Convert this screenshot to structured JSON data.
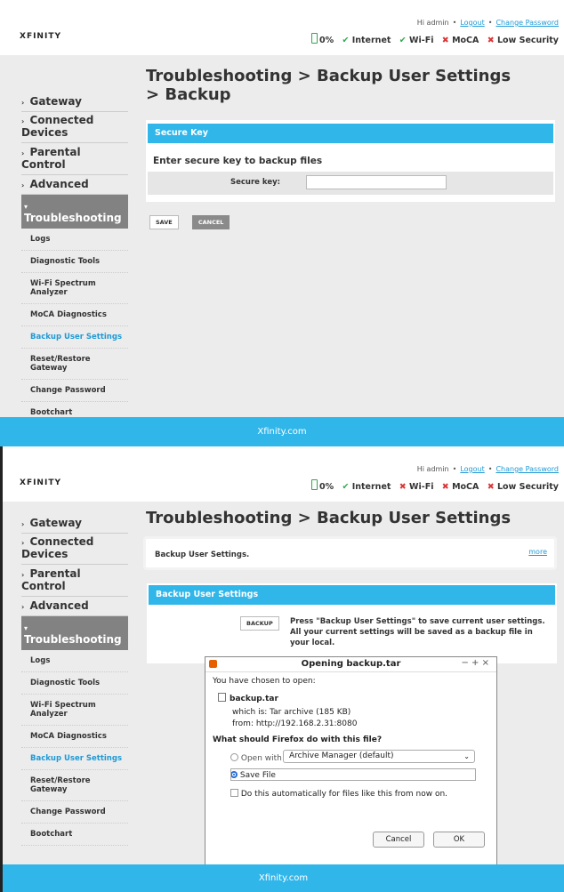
{
  "brand": "XFINITY",
  "user": {
    "greeting": "Hi admin",
    "sep": "•",
    "logout": "Logout",
    "change_password": "Change Password"
  },
  "status_top": {
    "battery": "0%",
    "internet": "Internet",
    "wifi": "Wi-Fi",
    "moca": "MoCA",
    "security": "Low Security"
  },
  "nav": {
    "gateway": "Gateway",
    "connected_devices": "Connected Devices",
    "parental_control": "Parental Control",
    "advanced": "Advanced",
    "troubleshooting": "Troubleshooting",
    "sub": [
      "Logs",
      "Diagnostic Tools",
      "Wi-Fi Spectrum Analyzer",
      "MoCA Diagnostics",
      "Backup User Settings",
      "Reset/Restore Gateway",
      "Change Password",
      "Bootchart"
    ]
  },
  "page1": {
    "title": "Troubleshooting > Backup User Settings > Backup",
    "section": "Secure Key",
    "heading": "Enter secure key to backup files",
    "label": "Secure key:",
    "key_value": "",
    "save": "SAVE",
    "cancel": "CANCEL"
  },
  "page2": {
    "title": "Troubleshooting > Backup User Settings",
    "intro": "Backup User Settings.",
    "more": "more",
    "section": "Backup User Settings",
    "backup_btn": "BACKUP",
    "desc": "Press \"Backup User Settings\" to save current user settings. All your current settings will be saved as a backup file in your local."
  },
  "dialog": {
    "title": "Opening backup.tar",
    "controls": "− + ×",
    "chosen": "You have chosen to open:",
    "filename": "backup.tar",
    "which_is": "which is: Tar archive (185 KB)",
    "from": "from: http://192.168.2.31:8080",
    "question": "What should Firefox do with this file?",
    "open_with": "Open with",
    "app": "Archive Manager (default)",
    "save_file": "Save File",
    "auto": "Do this automatically for files like this from now on.",
    "cancel": "Cancel",
    "ok": "OK"
  },
  "footer": "Xfinity.com",
  "colors": {
    "accent": "#31b6ea",
    "link": "#1e9ad6",
    "ok": "#2ea84a",
    "bad": "#d9383a"
  }
}
